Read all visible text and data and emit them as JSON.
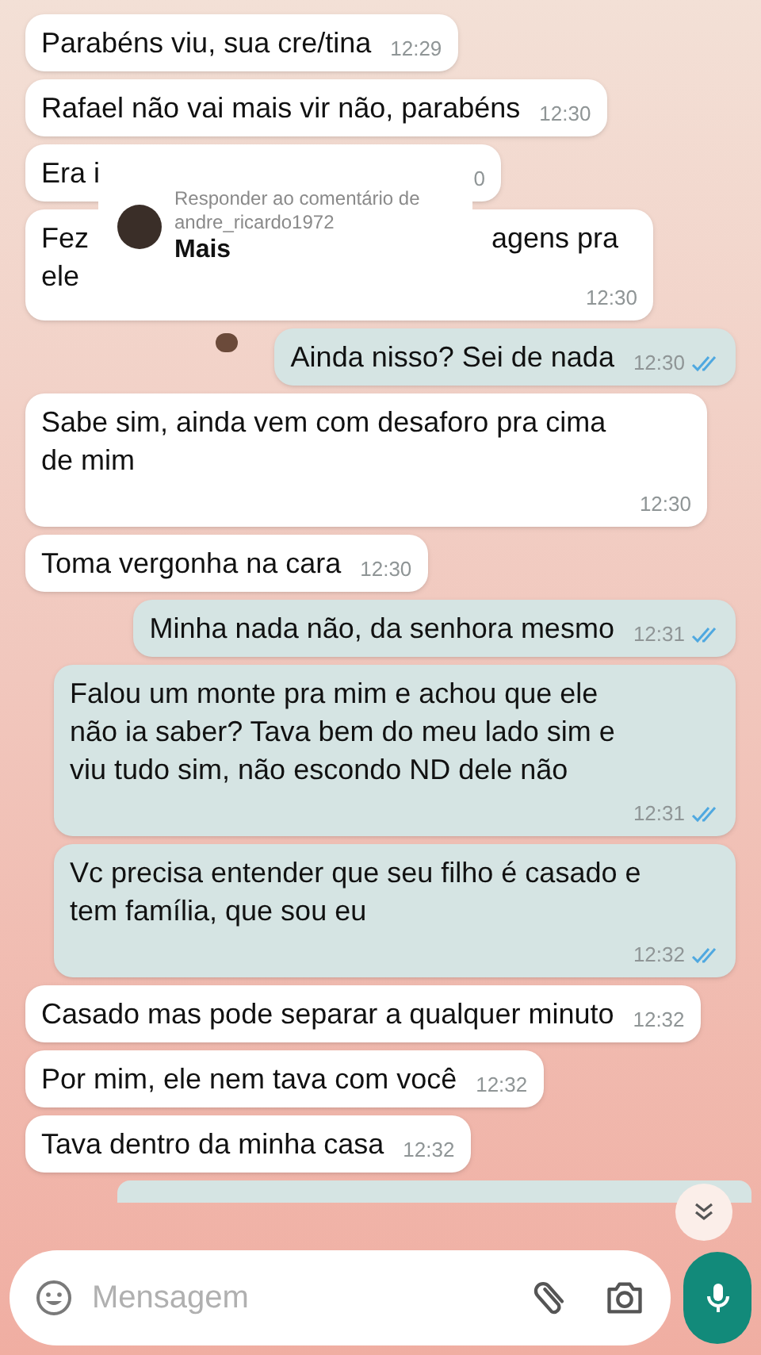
{
  "messages": [
    {
      "kind": "incoming",
      "text": "Parabéns viu, sua cre/tina",
      "time": "12:29"
    },
    {
      "kind": "incoming",
      "text": "Rafael não vai mais vir não, parabéns",
      "time": "12:30"
    },
    {
      "kind": "incoming",
      "fragments": [
        "Era i"
      ],
      "time": "0"
    },
    {
      "kind": "incoming",
      "fragments": [
        "Fez",
        "agens pra",
        "ele"
      ],
      "time": "12:30"
    },
    {
      "kind": "outgoing",
      "text": "Ainda nisso? Sei de nada",
      "time": "12:30",
      "read": true
    },
    {
      "kind": "incoming",
      "text": "Sabe sim, ainda vem com desaforo pra cima de mim",
      "time": "12:30"
    },
    {
      "kind": "incoming",
      "text": "Toma vergonha na cara",
      "time": "12:30"
    },
    {
      "kind": "outgoing",
      "text": "Minha nada não, da senhora mesmo",
      "time": "12:31",
      "read": true
    },
    {
      "kind": "outgoing",
      "text": "Falou um monte pra mim e achou que ele não ia saber? Tava bem do meu lado sim e viu tudo sim, não escondo ND dele não",
      "time": "12:31",
      "read": true
    },
    {
      "kind": "outgoing",
      "text": "Vc precisa entender que seu filho é casado e tem família, que sou eu",
      "time": "12:32",
      "read": true
    },
    {
      "kind": "incoming",
      "text": "Casado mas pode separar a qualquer minuto",
      "time": "12:32"
    },
    {
      "kind": "incoming",
      "text": "Por mim, ele nem tava com você",
      "time": "12:32"
    },
    {
      "kind": "incoming",
      "text": "Tava dentro da minha casa",
      "time": "12:32"
    },
    {
      "kind": "outgoing-cut"
    }
  ],
  "reply_sticker": {
    "title": "Responder ao comentário de andre_ricardo1972",
    "label": "Mais"
  },
  "composer": {
    "placeholder": "Mensagem"
  }
}
